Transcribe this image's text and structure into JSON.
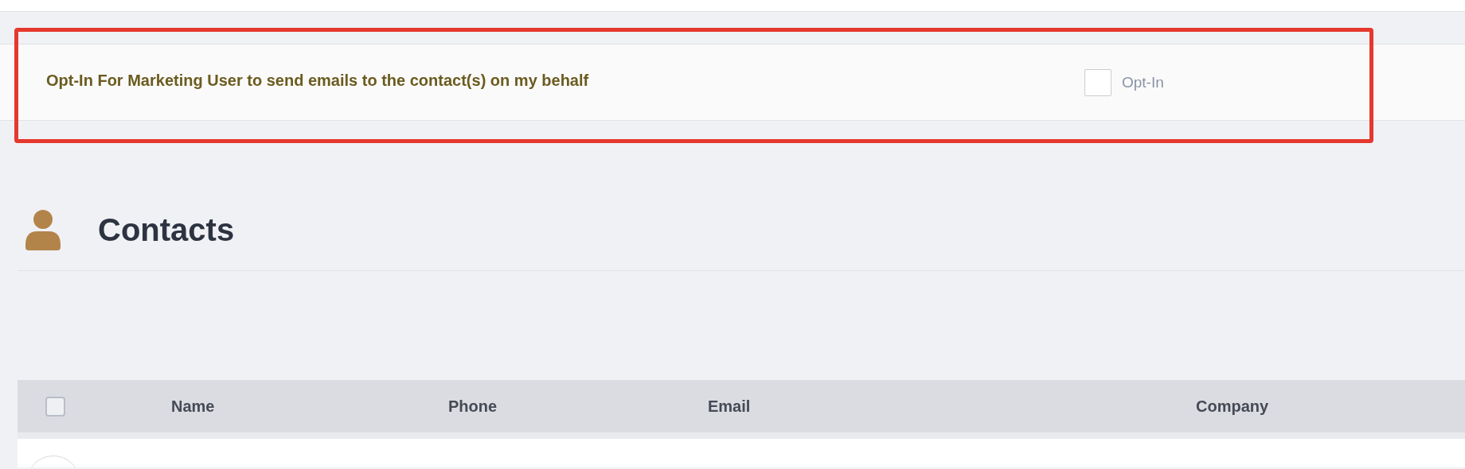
{
  "annotation": {
    "kind": "rectangle"
  },
  "opt_in": {
    "description": "Opt-In For Marketing User to send emails to the contact(s) on my behalf",
    "checkbox_label": "Opt-In",
    "checked": false
  },
  "page_header": {
    "title": "Contacts"
  },
  "table": {
    "select_all_checked": false,
    "columns": [
      "Name",
      "Phone",
      "Email",
      "Company"
    ],
    "rows": [
      {
        "avatar": true
      }
    ]
  }
}
